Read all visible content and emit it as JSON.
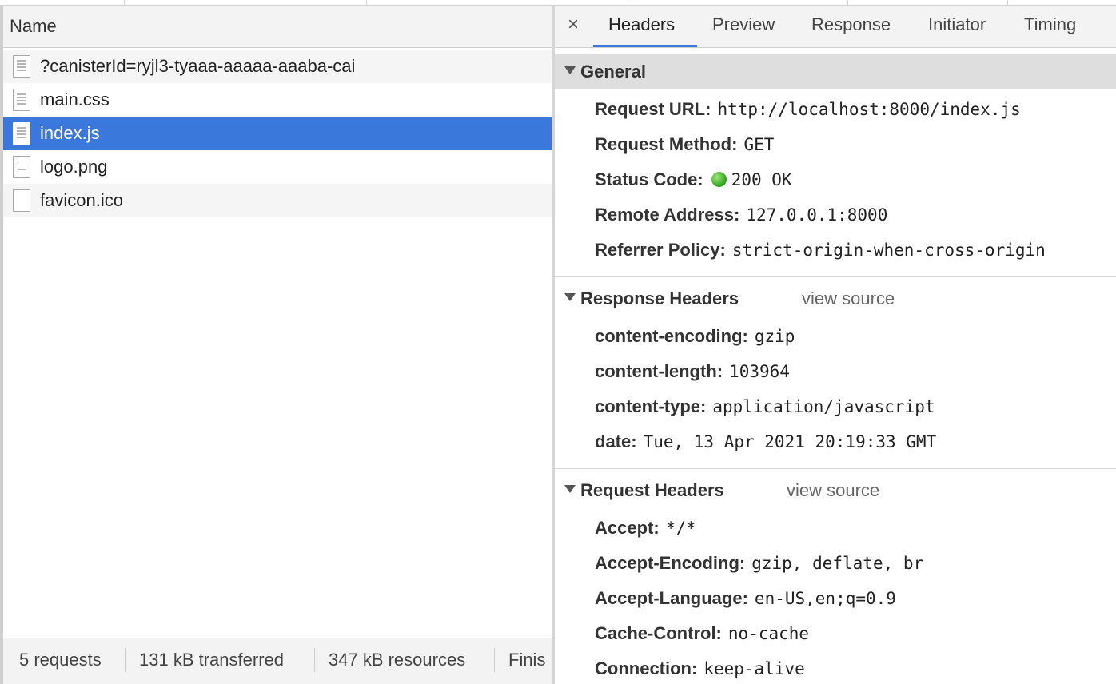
{
  "request_list": {
    "column_name": "Name",
    "rows": [
      {
        "name": "?canisterId=ryjl3-tyaaa-aaaaa-aaaba-cai",
        "icon": "document-icon"
      },
      {
        "name": "main.css",
        "icon": "document-icon"
      },
      {
        "name": "index.js",
        "icon": "document-icon"
      },
      {
        "name": "logo.png",
        "icon": "image-file-icon"
      },
      {
        "name": "favicon.ico",
        "icon": "blank-file-icon"
      }
    ],
    "selected_index": 2,
    "selection_color": "#3a78dc"
  },
  "footer": {
    "requests": "5 requests",
    "transferred": "131 kB transferred",
    "resources": "347 kB resources",
    "finish": "Finis"
  },
  "detail_tabs": {
    "close": "×",
    "items": [
      "Headers",
      "Preview",
      "Response",
      "Initiator",
      "Timing"
    ],
    "active": "Headers"
  },
  "general": {
    "title": "General",
    "items": [
      {
        "key": "Request URL:",
        "value": "http://localhost:8000/index.js"
      },
      {
        "key": "Request Method:",
        "value": "GET"
      },
      {
        "key": "Status Code:",
        "value": "200 OK",
        "status_color": "#33a51d"
      },
      {
        "key": "Remote Address:",
        "value": "127.0.0.1:8000"
      },
      {
        "key": "Referrer Policy:",
        "value": "strict-origin-when-cross-origin"
      }
    ]
  },
  "response_headers": {
    "title": "Response Headers",
    "view_source": "view source",
    "items": [
      {
        "key": "content-encoding:",
        "value": "gzip"
      },
      {
        "key": "content-length:",
        "value": "103964"
      },
      {
        "key": "content-type:",
        "value": "application/javascript"
      },
      {
        "key": "date:",
        "value": "Tue, 13 Apr 2021 20:19:33 GMT"
      }
    ]
  },
  "request_headers": {
    "title": "Request Headers",
    "view_source": "view source",
    "items": [
      {
        "key": "Accept:",
        "value": "*/*"
      },
      {
        "key": "Accept-Encoding:",
        "value": "gzip, deflate, br"
      },
      {
        "key": "Accept-Language:",
        "value": "en-US,en;q=0.9"
      },
      {
        "key": "Cache-Control:",
        "value": "no-cache"
      },
      {
        "key": "Connection:",
        "value": "keep-alive"
      }
    ]
  }
}
